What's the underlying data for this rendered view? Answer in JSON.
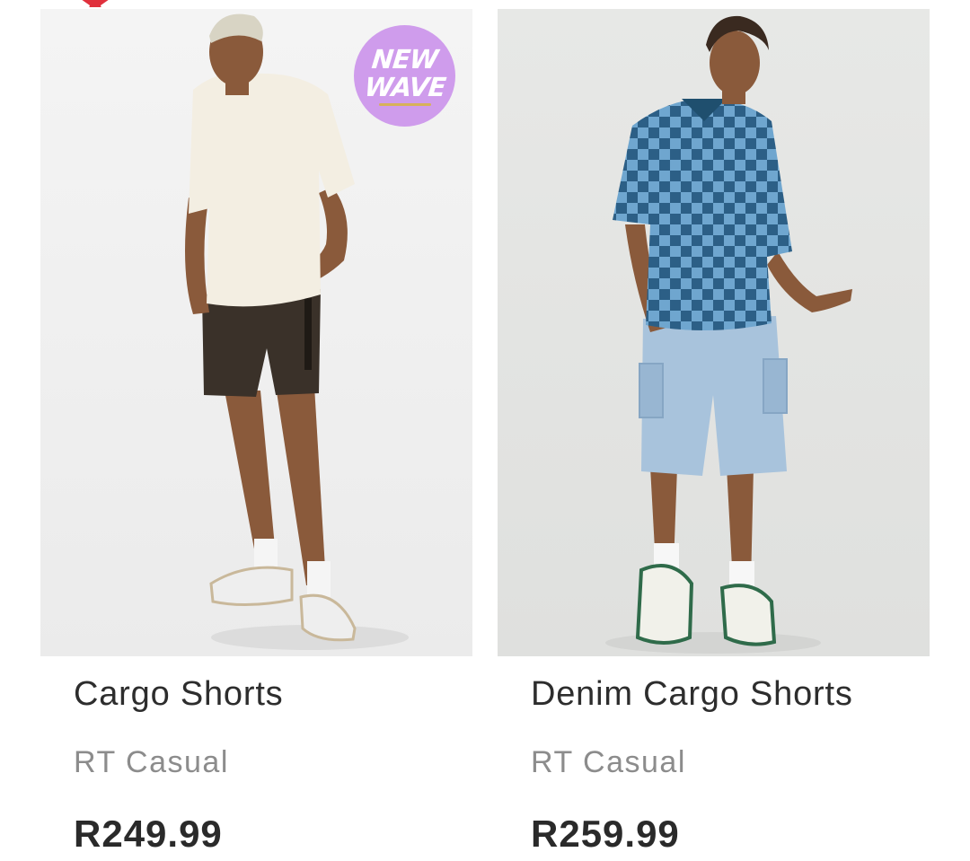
{
  "products": [
    {
      "name": "Cargo Shorts",
      "brand": "RT Casual",
      "price": "R249.99",
      "badge": {
        "line1": "NEW",
        "line2": "WAVE",
        "color": "#cf9cec"
      },
      "image_icon": "model-white-tee-dark-shorts"
    },
    {
      "name": "Denim Cargo Shorts",
      "brand": "RT Casual",
      "price": "R259.99",
      "image_icon": "model-checkered-tee-denim-shorts"
    }
  ],
  "colors": {
    "accent_star": "#e0303c",
    "badge": "#cf9cec",
    "title": "#2d2d2d",
    "brand": "#8c8c8c",
    "price": "#2a2a2a"
  }
}
